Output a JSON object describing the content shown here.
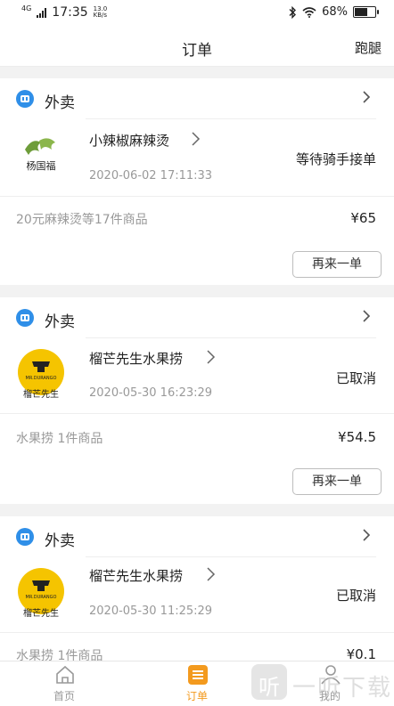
{
  "status_bar": {
    "network": "4G",
    "time": "17:35",
    "speed_value": "13.0",
    "speed_unit": "KB/s",
    "battery": "68%",
    "battery_level": 0.68,
    "icons": [
      "signal-icon",
      "bluetooth-icon",
      "wifi-icon",
      "battery-icon"
    ]
  },
  "header": {
    "title": "订单",
    "right_link": "跑腿"
  },
  "orders": [
    {
      "type_label": "外卖",
      "shop_name": "小辣椒麻辣烫",
      "time": "2020-06-02 17:11:33",
      "status": "等待骑手接单",
      "goods": "20元麻辣烫等17件商品",
      "price": "¥65",
      "reorder_label": "再来一单",
      "logo_text": "杨国福"
    },
    {
      "type_label": "外卖",
      "shop_name": "榴芒先生水果捞",
      "time": "2020-05-30 16:23:29",
      "status": "已取消",
      "goods": "水果捞 1件商品",
      "price": "¥54.5",
      "reorder_label": "再来一单",
      "logo_text": "榴芒先生",
      "logo_brand": "MR.DURANGO"
    },
    {
      "type_label": "外卖",
      "shop_name": "榴芒先生水果捞",
      "time": "2020-05-30 11:25:29",
      "status": "已取消",
      "goods": "水果捞 1件商品",
      "price": "¥0.1",
      "logo_text": "榴芒先生",
      "logo_brand": "MR.DURANGO"
    }
  ],
  "tabs": [
    {
      "label": "首页",
      "icon": "home-icon",
      "active": false
    },
    {
      "label": "订单",
      "icon": "order-list-icon",
      "active": true
    },
    {
      "label": "我的",
      "icon": "profile-icon",
      "active": false
    }
  ],
  "colors": {
    "accent": "#f39a1e",
    "tag_blue": "#2f8fe8",
    "muted_text": "#999999"
  },
  "watermark": {
    "logo_glyph": "听",
    "text": "一听下载"
  }
}
